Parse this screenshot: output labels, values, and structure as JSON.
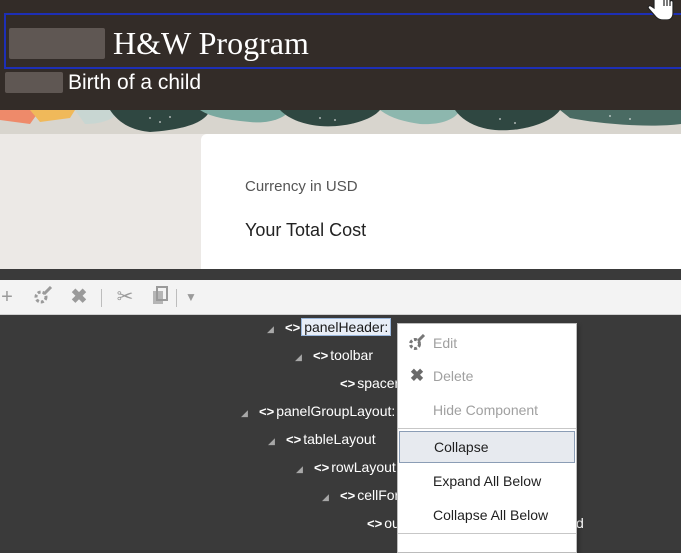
{
  "header": {
    "title": "H&W Program",
    "subtitle": "Birth of a child",
    "frame_color": "#1d2fb6"
  },
  "content": {
    "currency_label": "Currency in USD",
    "total_label": "Your Total Cost"
  },
  "toolbar": {
    "icons": [
      "add-icon",
      "edit-icon",
      "delete-icon",
      "cut-icon",
      "copy-icon",
      "dropdown-arrow-icon"
    ]
  },
  "tree": {
    "nodes": [
      {
        "name": "panelHeader:",
        "selected": true
      },
      {
        "name": "toolbar"
      },
      {
        "name": "spacer"
      },
      {
        "name": "panelGroupLayout:"
      },
      {
        "name": "tableLayout"
      },
      {
        "name": "rowLayout"
      },
      {
        "name": "cellFor"
      },
      {
        "name": "ou"
      }
    ],
    "trailing_fragment": "d"
  },
  "context_menu": {
    "items": [
      {
        "label": "Edit",
        "disabled": true,
        "icon": "edit-icon"
      },
      {
        "label": "Delete",
        "disabled": true,
        "icon": "delete-icon"
      },
      {
        "label": "Hide Component",
        "disabled": true
      },
      {
        "label": "Collapse",
        "active": true
      },
      {
        "label": "Expand All Below"
      },
      {
        "label": "Collapse All Below"
      }
    ]
  }
}
